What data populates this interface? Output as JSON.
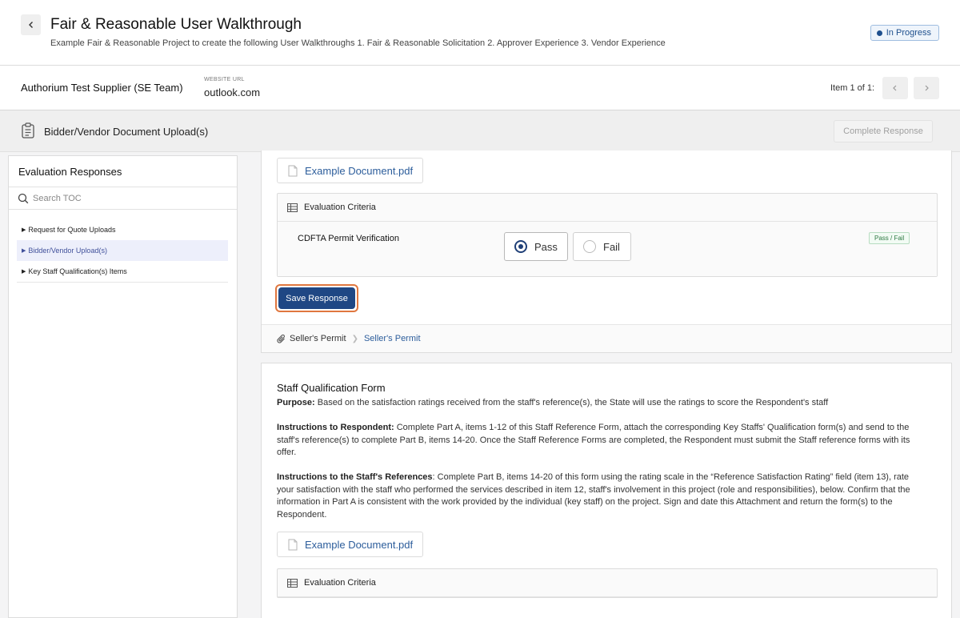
{
  "header": {
    "title": "Fair & Reasonable User Walkthrough",
    "description": "Example Fair & Reasonable Project to create the following User Walkthroughs 1. Fair & Reasonable Solicitation 2. Approver Experience 3. Vendor Experience",
    "status": "In Progress"
  },
  "supplier": {
    "name": "Authorium Test Supplier (SE Team)",
    "website_label": "WEBSITE URL",
    "website": "outlook.com",
    "item_count": "Item 1 of 1:"
  },
  "section": {
    "title": "Bidder/Vendor Document Upload(s)",
    "complete_label": "Complete Response"
  },
  "sidebar": {
    "title": "Evaluation Responses",
    "search_placeholder": "Search TOC",
    "items": [
      {
        "label": "Request for Quote Uploads",
        "active": false
      },
      {
        "label": "Bidder/Vendor Upload(s)",
        "active": true
      },
      {
        "label": "Key Staff Qualification(s) Items",
        "active": false
      }
    ]
  },
  "card1": {
    "document": "Example Document.pdf",
    "criteria_title": "Evaluation Criteria",
    "criterion_label": "CDFTA Permit Verification",
    "option_pass": "Pass",
    "option_fail": "Fail",
    "selected": "Pass",
    "criterion_type": "Pass / Fail",
    "save_label": "Save Response",
    "breadcrumb_item": "Seller's Permit",
    "breadcrumb_link": "Seller's Permit"
  },
  "card2": {
    "title": "Staff Qualification Form",
    "purpose_label": "Purpose:",
    "purpose_text": " Based on the satisfaction ratings received from the staff's reference(s), the State will use the ratings to score the Respondent's staff",
    "instructions_label": "Instructions to Respondent:",
    "instructions_text": " Complete Part A, items 1-12 of this Staff Reference Form, attach the corresponding Key Staffs' Qualification form(s) and send to the staff's reference(s) to complete Part B, items 14-20. Once the Staff Reference Forms are completed, the Respondent must submit the Staff reference forms with its offer.",
    "references_label": "Instructions to the Staff's References",
    "references_text": ": Complete Part B, items 14-20 of this form using the rating scale in the “Reference Satisfaction Rating” field (item 13), rate your satisfaction with the staff who performed the services described in item 12, staff's involvement in this project (role and responsibilities), below. Confirm that the information in Part A is consistent with the work provided by the individual (key staff) on the project. Sign and date this Attachment and return the form(s) to the Respondent.",
    "document": "Example Document.pdf",
    "criteria_title": "Evaluation Criteria"
  },
  "colors": {
    "primary": "#1f4784",
    "link": "#2c5d9b",
    "highlight_ring": "#e0773f",
    "success": "#2f7a44"
  }
}
